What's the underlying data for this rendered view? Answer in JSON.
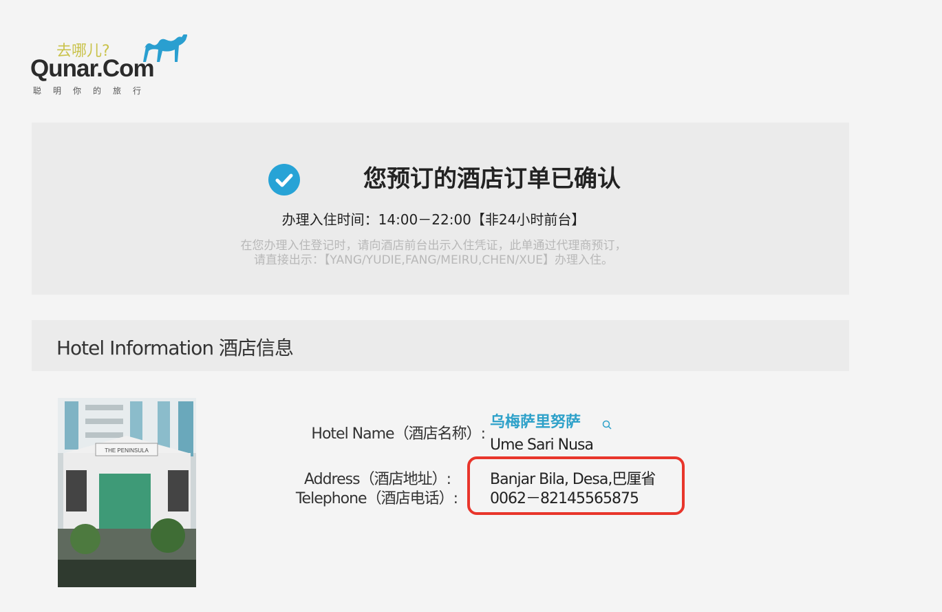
{
  "logo": {
    "slogan": "去哪儿?",
    "brand": "Qunar.Com",
    "tagline": "聪明你的旅行"
  },
  "confirmation": {
    "title": "您预订的酒店订单已确认",
    "checkin": "办理入住时间：14:00－22:00【非24小时前台】",
    "notice_line1": "在您办理入住登记时，请向酒店前台出示入住凭证，此单通过代理商预订，",
    "notice_line2": "请直接出示：【YANG/YUDIE,FANG/MEIRU,CHEN/XUE】办理入住。"
  },
  "hotel_info": {
    "section_title": "Hotel Information 酒店信息",
    "name_label": "Hotel Name（酒店名称）:",
    "name_cn": "乌梅萨里努萨",
    "name_en": "Ume Sari Nusa",
    "address_label": "Address（酒店地址）:",
    "address_value": "Banjar Bila, Desa,巴厘省",
    "phone_label": "Telephone（酒店电话）:",
    "phone_value": "0062－82145565875",
    "photo_sign": "THE PENINSULA"
  },
  "colors": {
    "accent": "#27a3d6",
    "highlight_border": "#e8352b",
    "hotel_link": "#2ea1c9"
  }
}
